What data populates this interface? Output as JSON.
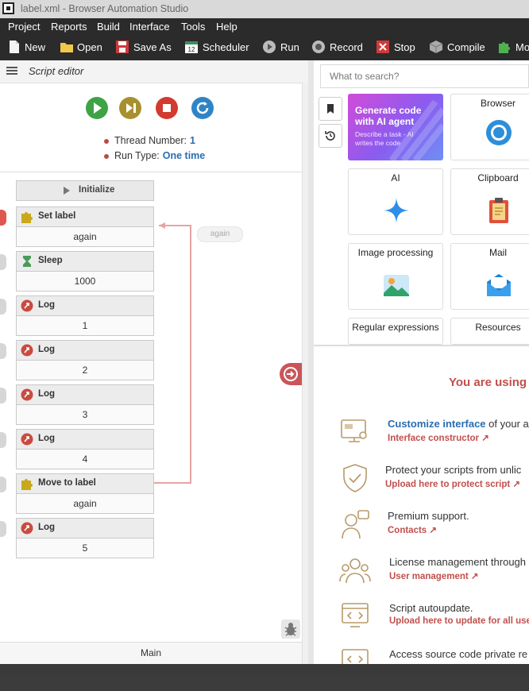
{
  "window": {
    "title": "label.xml - Browser Automation Studio"
  },
  "menu": [
    "Project",
    "Reports",
    "Build",
    "Interface",
    "Tools",
    "Help"
  ],
  "toolbar": {
    "new": "New",
    "open": "Open",
    "save_as": "Save As",
    "scheduler": "Scheduler",
    "run": "Run",
    "record": "Record",
    "stop": "Stop",
    "compile": "Compile",
    "modules": "Mo"
  },
  "editor": {
    "title": "Script editor",
    "thread_label": "Thread Number:",
    "thread_value": "1",
    "runtype_label": "Run Type:",
    "runtype_value": "One time",
    "initialize": "Initialize",
    "again_tag": "again",
    "footer_tab": "Main",
    "blocks": [
      {
        "title": "Set label",
        "value": "again"
      },
      {
        "title": "Sleep",
        "value": "1000"
      },
      {
        "title": "Log",
        "value": "1"
      },
      {
        "title": "Log",
        "value": "2"
      },
      {
        "title": "Log",
        "value": "3"
      },
      {
        "title": "Log",
        "value": "4"
      },
      {
        "title": "Move to label",
        "value": "again"
      },
      {
        "title": "Log",
        "value": "5"
      }
    ]
  },
  "actions": {
    "search_placeholder": "What to search?",
    "ai_card": {
      "title": "Generate code with AI agent",
      "subtitle": "Describe a task - AI writes the code"
    },
    "cards": [
      "Browser",
      "AI",
      "Clipboard",
      "Image processing",
      "Mail",
      "Regular expressions",
      "Resources"
    ]
  },
  "promo": {
    "title": "You are using p",
    "features": [
      {
        "pre": "Customize interface",
        "text": " of your a",
        "link": "Interface constructor"
      },
      {
        "pre": "",
        "text": "Protect your scripts from unlic",
        "link": "Upload here to protect script"
      },
      {
        "pre": "",
        "text": "Premium support.",
        "link": "Contacts"
      },
      {
        "pre": "",
        "text": "License management through",
        "link": "User management"
      },
      {
        "pre": "",
        "text": "Script autoupdate.",
        "link": "Upload here to update for all user"
      },
      {
        "pre": "",
        "text": "Access source code private re",
        "link": ""
      }
    ]
  },
  "colors": {
    "accent_red": "#c0504d",
    "accent_blue": "#2a6db0",
    "toolbar_bg": "#2b2b2b"
  }
}
